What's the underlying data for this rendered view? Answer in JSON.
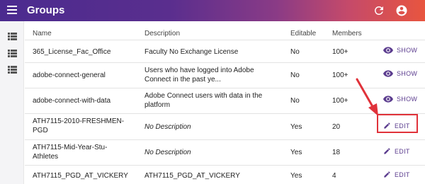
{
  "app": {
    "title": "Groups"
  },
  "table": {
    "headers": {
      "name": "Name",
      "description": "Description",
      "editable": "Editable",
      "members": "Members"
    },
    "rows": [
      {
        "name": "365_License_Fac_Office",
        "description": "Faculty No Exchange License",
        "editable": "No",
        "members": "100+",
        "action": "SHOW"
      },
      {
        "name": "adobe-connect-general",
        "description": "Users who have logged into Adobe Connect in the past ye...",
        "editable": "No",
        "members": "100+",
        "action": "SHOW"
      },
      {
        "name": "adobe-connect-with-data",
        "description": "Adobe Connect users with data in the platform",
        "editable": "No",
        "members": "100+",
        "action": "SHOW"
      },
      {
        "name": "ATH7115-2010-FRESHMEN-PGD",
        "description": "No Description",
        "editable": "Yes",
        "members": "20",
        "action": "EDIT"
      },
      {
        "name": "ATH7115-Mid-Year-Stu-Athletes",
        "description": "No Description",
        "editable": "Yes",
        "members": "18",
        "action": "EDIT"
      },
      {
        "name": "ATH7115_PGD_AT_VICKERY",
        "description": "ATH7115_PGD_AT_VICKERY",
        "editable": "Yes",
        "members": "4",
        "action": "EDIT"
      }
    ]
  },
  "colors": {
    "accent": "#5c3d8f",
    "highlight": "#e0323a"
  },
  "icons": {
    "menu": "menu-icon",
    "refresh": "refresh-icon",
    "account": "account-icon",
    "show": "eye-icon",
    "edit": "pencil-icon",
    "sidebar": "list-icon"
  }
}
